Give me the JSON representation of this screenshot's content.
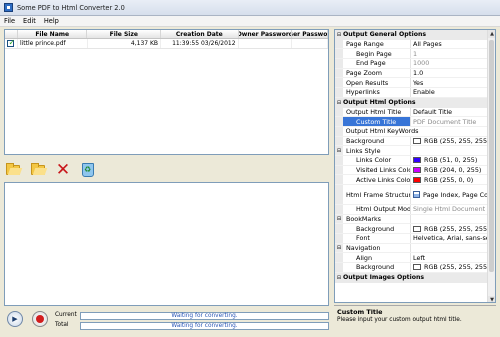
{
  "window": {
    "title": "Some PDF to Html Converter 2.0"
  },
  "menu": [
    "File",
    "Edit",
    "Help"
  ],
  "file_table": {
    "columns": [
      "File Name",
      "File Size",
      "Creation Date",
      "Owner Password",
      "User Password"
    ],
    "rows": [
      {
        "checked": true,
        "name": "little prince.pdf",
        "size": "4,137 KB",
        "date": "11:39:55 03/26/2012",
        "owner": "",
        "user": ""
      }
    ]
  },
  "toolbar": {
    "add_file": "add-file-icon",
    "add_folder": "add-folder-icon",
    "delete": "delete-icon",
    "clear": "clear-icon"
  },
  "properties": {
    "cat_general": "Output General Options",
    "page_range": {
      "label": "Page Range",
      "value": "All Pages"
    },
    "begin_page": {
      "label": "Begin Page",
      "value": "1"
    },
    "end_page": {
      "label": "End Page",
      "value": "1000"
    },
    "page_zoom": {
      "label": "Page Zoom",
      "value": "1.0"
    },
    "open_results": {
      "label": "Open Results",
      "value": "Yes"
    },
    "hyperlinks": {
      "label": "Hyperlinks",
      "value": "Enable"
    },
    "cat_html": "Output Html Options",
    "html_title": {
      "label": "Output Html Title",
      "value": "Default Title"
    },
    "custom_title": {
      "label": "Custom Title",
      "value": "PDF Document Title"
    },
    "html_keywords": {
      "label": "Output Html KeyWords",
      "value": ""
    },
    "background": {
      "label": "Background",
      "value": "RGB (255, 255, 255)",
      "color": "#ffffff"
    },
    "links_style": {
      "label": "Links Style"
    },
    "links_color": {
      "label": "Links Color",
      "value": "RGB (51, 0, 255)",
      "color": "#3300ff"
    },
    "visited_color": {
      "label": "Visited Links Color",
      "value": "RGB (204, 0, 255)",
      "color": "#cc00ff"
    },
    "active_color": {
      "label": "Active Links Color",
      "value": "RGB (255, 0, 0)",
      "color": "#ff0000"
    },
    "frame_structures": {
      "label": "Html Frame Structures",
      "value": "Page Index, Page Con"
    },
    "output_mode": {
      "label": "Html Output Mode",
      "value": "Single Html Document"
    },
    "bookmarks": {
      "label": "BookMarks"
    },
    "bm_background": {
      "label": "Background",
      "value": "RGB (255, 255, 255)",
      "color": "#ffffff"
    },
    "bm_font": {
      "label": "Font",
      "value": "Helvetica, Arial, sans-serif"
    },
    "navigation": {
      "label": "Navigation"
    },
    "nav_align": {
      "label": "Align",
      "value": "Left"
    },
    "nav_background": {
      "label": "Background",
      "value": "RGB (255, 255, 255)",
      "color": "#ffffff"
    },
    "cat_images": "Output Images Options"
  },
  "description": {
    "title": "Custom Title",
    "text": "Please input your custom output html title."
  },
  "status": {
    "current_label": "Current",
    "current_text": "Waiting for converting.",
    "total_label": "Total",
    "total_text": "Waiting for converting."
  }
}
